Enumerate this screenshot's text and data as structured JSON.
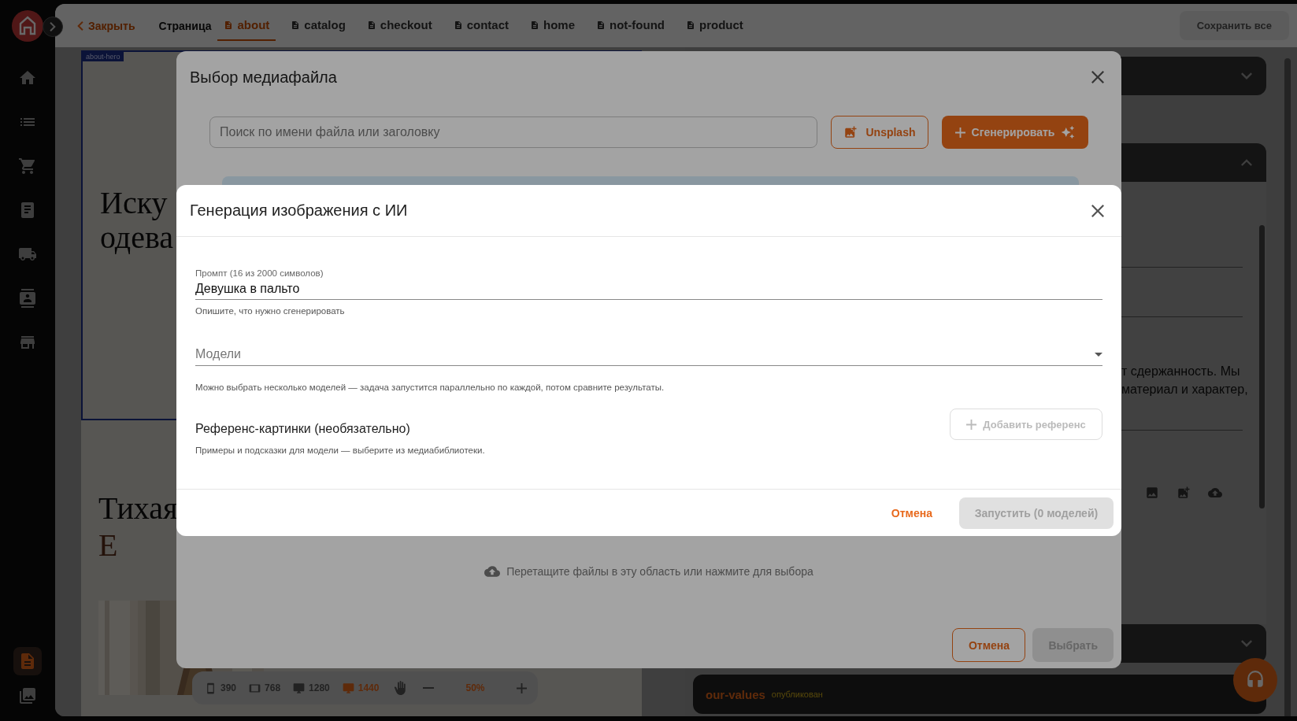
{
  "sidebar": {
    "items": [
      {
        "kind": "home",
        "selected": false
      },
      {
        "kind": "list",
        "selected": false
      },
      {
        "kind": "cart",
        "selected": false
      },
      {
        "kind": "receipt",
        "selected": false
      },
      {
        "kind": "truck",
        "selected": false
      },
      {
        "kind": "contacts",
        "selected": false
      },
      {
        "kind": "store",
        "selected": false
      }
    ],
    "bottom_items": [
      {
        "kind": "page",
        "selected": true
      },
      {
        "kind": "media",
        "selected": false
      }
    ]
  },
  "topbar": {
    "close_link": "Закрыть",
    "page_label": "Страница",
    "tabs": [
      {
        "label": "about",
        "selected": true
      },
      {
        "label": "catalog",
        "selected": false
      },
      {
        "label": "checkout",
        "selected": false
      },
      {
        "label": "contact",
        "selected": false
      },
      {
        "label": "home",
        "selected": false
      },
      {
        "label": "not-found",
        "selected": false
      },
      {
        "label": "product",
        "selected": false
      }
    ],
    "save_button": {
      "label": "Сохранить все",
      "disabled": true
    }
  },
  "preview": {
    "section_tag": "about-hero",
    "hero_heading": [
      "Иску",
      "одева"
    ],
    "section_heading": "Тихая",
    "drop_cap": "Е"
  },
  "viewport_toolbar": {
    "sizes": [
      {
        "kind": "phone",
        "label": "390",
        "selected": false
      },
      {
        "kind": "tablet",
        "label": "768",
        "selected": false
      },
      {
        "kind": "desktop",
        "label": "1280",
        "selected": false
      },
      {
        "kind": "desktop",
        "label": "1440",
        "selected": true
      }
    ],
    "zoom": "50%"
  },
  "right_panel": {
    "sections": [
      {
        "kind": "accordion",
        "expanded": false
      },
      {
        "kind": "accordion",
        "expanded": true,
        "text_lines": [
          "т сдержанность. Мы",
          "материал и характер,"
        ]
      },
      {
        "kind": "accordion",
        "expanded": false
      },
      {
        "kind": "page-card",
        "title": "our-values",
        "status": "опубликован"
      }
    ]
  },
  "media_dialog": {
    "title": "Выбор медиафайла",
    "search": {
      "placeholder": "Поиск по имени файла или заголовку"
    },
    "unsplash_button": "Unsplash",
    "generate_button": "Сгенерировать",
    "dropzone_text": "Перетащите файлы в эту область или нажмите для выбора",
    "cancel_button": "Отмена",
    "select_button": {
      "label": "Выбрать",
      "disabled": true
    }
  },
  "ai_dialog": {
    "title": "Генерация изображения с ИИ",
    "prompt": {
      "label": "Промпт (16 из 2000 символов)",
      "value": "Девушка в пальто",
      "helper": "Опишите, что нужно сгенерировать"
    },
    "models": {
      "placeholder": "Модели",
      "helper": "Можно выбрать несколько моделей — задача запустится параллельно по каждой, потом сравните результаты."
    },
    "references": {
      "title": "Референс-картинки (необязательно)",
      "subtitle": "Примеры и подсказки для модели — выберите из медиабиблиотеки.",
      "add_button": {
        "label": "Добавить референс",
        "disabled": true
      }
    },
    "cancel_button": "Отмена",
    "run_button": {
      "label": "Запустить (0 моделей)",
      "disabled": true
    }
  }
}
